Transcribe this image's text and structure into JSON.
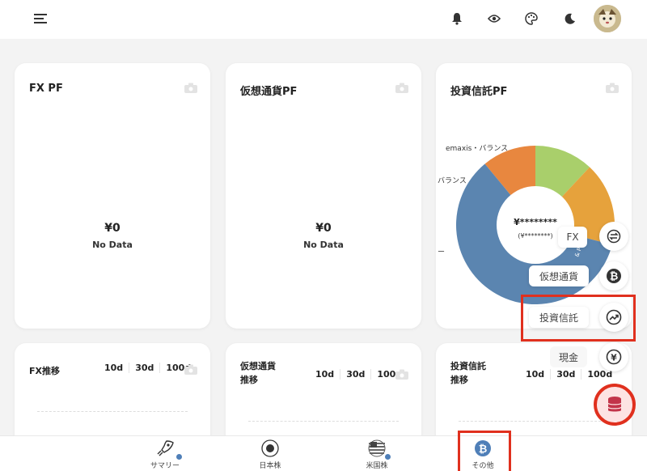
{
  "header": {
    "icons": [
      "menu-icon",
      "bell-icon",
      "eye-icon",
      "palette-icon",
      "moon-icon",
      "avatar"
    ]
  },
  "cards": {
    "fx": {
      "title": "FX PF",
      "value": "¥0",
      "status": "No Data"
    },
    "crypto": {
      "title": "仮想通貨PF",
      "value": "¥0",
      "status": "No Data"
    },
    "fund": {
      "title": "投資信託PF",
      "center_value": "¥********",
      "center_sub": "(¥********)",
      "labels": [
        "emaxis・バランス",
        "バランス",
        "ー"
      ]
    }
  },
  "trend_cards": {
    "fx": {
      "title": "FX推移",
      "ranges": [
        "10d",
        "30d",
        "100d"
      ]
    },
    "crypto": {
      "title_line1": "仮想通貨",
      "title_line2": "推移",
      "ranges": [
        "10d",
        "30d",
        "100d"
      ]
    },
    "fund": {
      "title_line1": "投資信託",
      "title_line2": "推移",
      "ranges": [
        "10d",
        "30d",
        "100d"
      ]
    }
  },
  "fab_menu": {
    "items": [
      {
        "label": "FX",
        "icon": "exchange-icon"
      },
      {
        "label": "仮想通貨",
        "icon": "bitcoin-icon"
      },
      {
        "label": "投資信託",
        "icon": "trend-up-icon"
      },
      {
        "label": "現金",
        "icon": "yen-icon"
      }
    ],
    "main_icon": "database-icon"
  },
  "bottom_nav": {
    "tabs": [
      {
        "label": "サマリー",
        "icon": "rocket-icon"
      },
      {
        "label": "日本株",
        "icon": "japan-flag-icon"
      },
      {
        "label": "米国株",
        "icon": "us-flag-icon"
      },
      {
        "label": "その他",
        "icon": "bitcoin-icon"
      }
    ]
  },
  "colors": {
    "accent_red": "#e0301e",
    "pie_blue": "#5b85b0",
    "pie_orange": "#e6a23c",
    "pie_green": "#a9cf6b",
    "pie_dark_orange": "#e8873f"
  },
  "chart_data": {
    "type": "pie",
    "series": [
      {
        "name": "emaxis・バランス",
        "value": 11
      },
      {
        "name": "バランス",
        "value": 12
      },
      {
        "name": "ー",
        "value": 17
      },
      {
        "name": "",
        "value": 60
      }
    ]
  }
}
